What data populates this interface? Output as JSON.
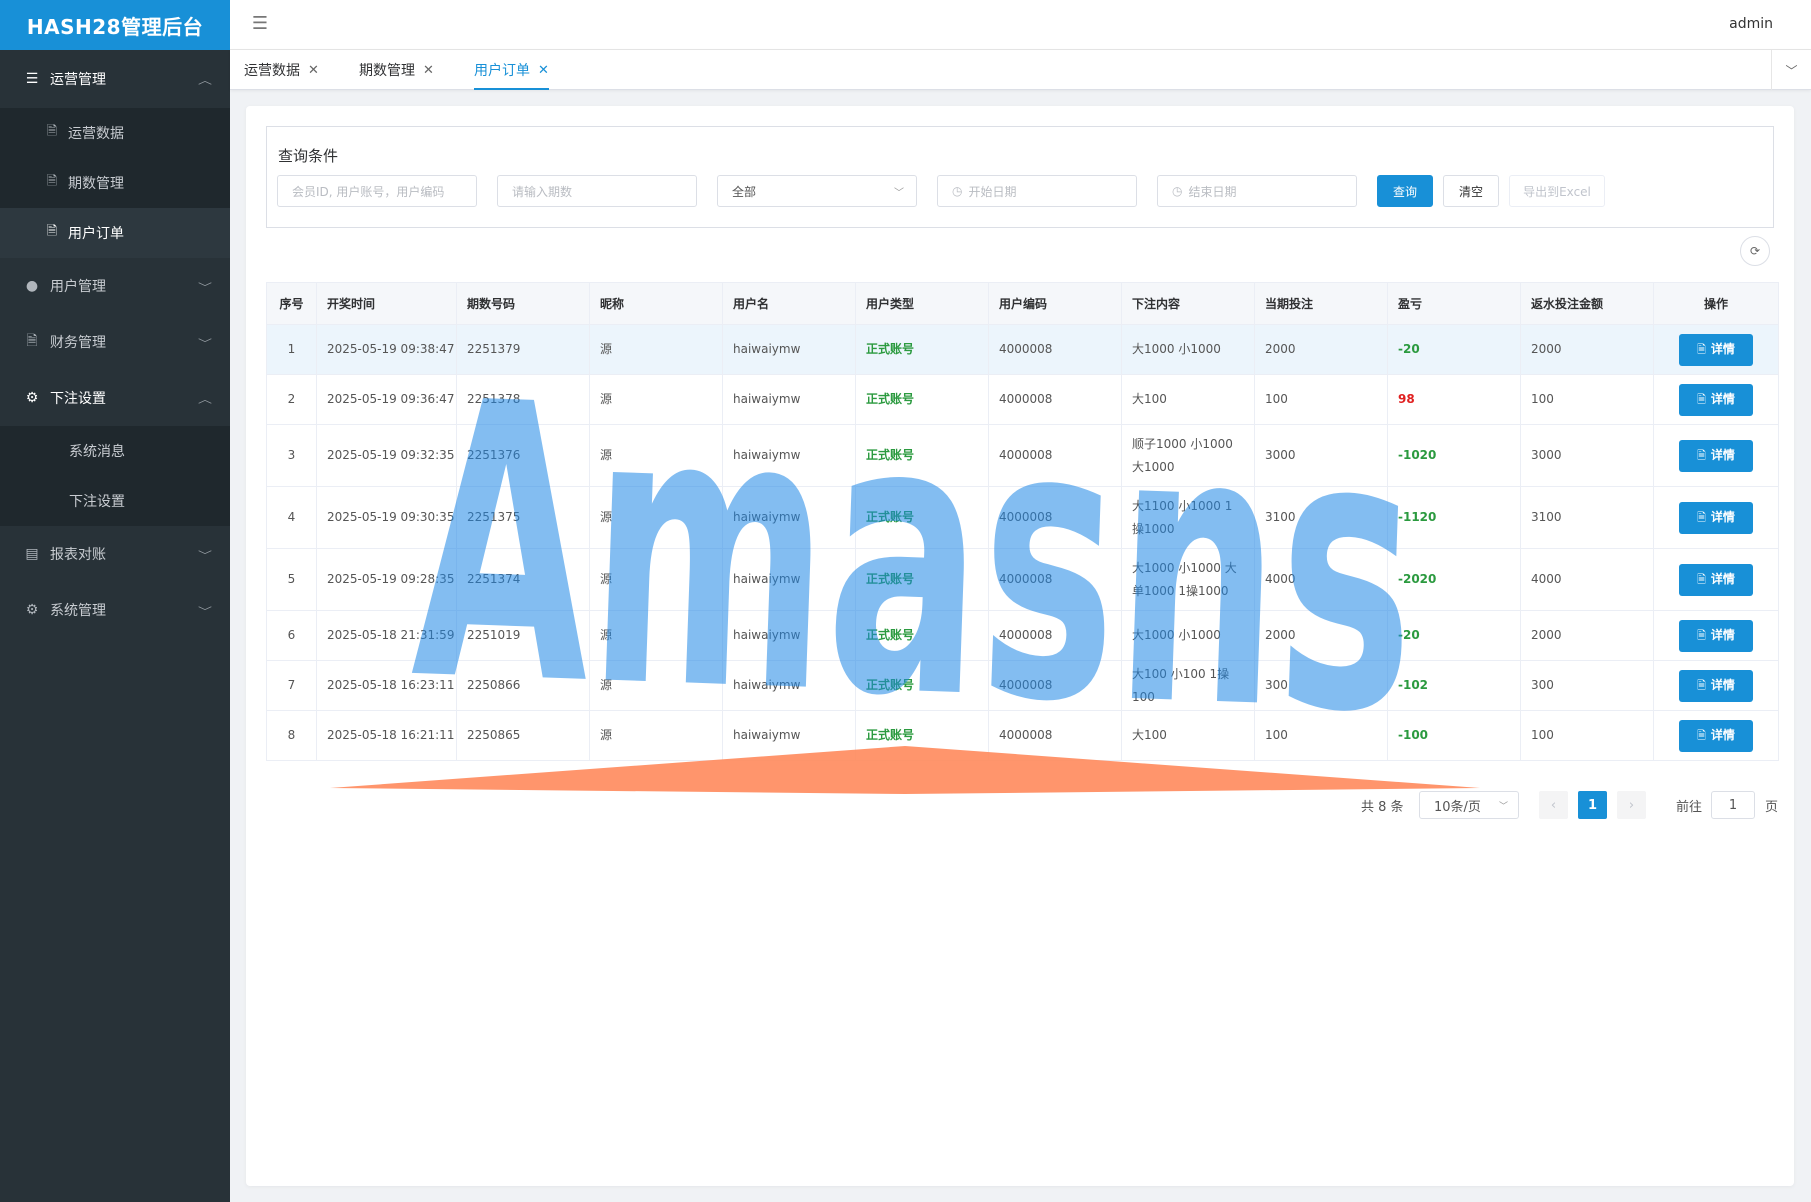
{
  "app": {
    "logo_text": "HASH28管理后台",
    "user": "admin"
  },
  "sidebar": {
    "groups": [
      {
        "label": "运营管理",
        "icon": "list-icon",
        "open": true,
        "items": [
          {
            "label": "运营数据",
            "icon": "doc-icon"
          },
          {
            "label": "期数管理",
            "icon": "doc-icon"
          },
          {
            "label": "用户订单",
            "icon": "doc-icon",
            "active": true
          }
        ]
      },
      {
        "label": "用户管理",
        "icon": "user-icon"
      },
      {
        "label": "财务管理",
        "icon": "doc-icon"
      },
      {
        "label": "下注设置",
        "icon": "gear-icon",
        "open": true,
        "items": [
          {
            "label": "系统消息"
          },
          {
            "label": "下注设置"
          }
        ]
      },
      {
        "label": "报表对账",
        "icon": "report-icon"
      },
      {
        "label": "系统管理",
        "icon": "gear-icon"
      }
    ]
  },
  "tabs": [
    {
      "label": "运营数据"
    },
    {
      "label": "期数管理"
    },
    {
      "label": "用户订单",
      "active": true
    }
  ],
  "query": {
    "title": "查询条件",
    "member_placeholder": "会员ID, 用户账号，用户编码",
    "period_placeholder": "请输入期数",
    "select_value": "全部",
    "start_placeholder": "开始日期",
    "end_placeholder": "结束日期",
    "search_label": "查询",
    "clear_label": "清空",
    "export_label": "导出到Excel"
  },
  "table": {
    "headers": [
      "序号",
      "开奖时间",
      "期数号码",
      "昵称",
      "用户名",
      "用户类型",
      "用户编码",
      "下注内容",
      "当期投注",
      "盈亏",
      "返水投注金额",
      "操作"
    ],
    "detail_label": "详情",
    "rows": [
      {
        "no": "1",
        "time": "2025-05-19 09:38:47",
        "period": "2251379",
        "nick": "源",
        "user": "haiwaiymw",
        "type": "正式账号",
        "code": "4000008",
        "bet": "大1000 小1000",
        "amount": "2000",
        "pl": "-20",
        "rebate": "2000"
      },
      {
        "no": "2",
        "time": "2025-05-19 09:36:47",
        "period": "2251378",
        "nick": "源",
        "user": "haiwaiymw",
        "type": "正式账号",
        "code": "4000008",
        "bet": "大100",
        "amount": "100",
        "pl": "98",
        "rebate": "100"
      },
      {
        "no": "3",
        "time": "2025-05-19 09:32:35",
        "period": "2251376",
        "nick": "源",
        "user": "haiwaiymw",
        "type": "正式账号",
        "code": "4000008",
        "bet": "顺子1000 小1000 大1000",
        "amount": "3000",
        "pl": "-1020",
        "rebate": "3000"
      },
      {
        "no": "4",
        "time": "2025-05-19 09:30:35",
        "period": "2251375",
        "nick": "源",
        "user": "haiwaiymw",
        "type": "正式账号",
        "code": "4000008",
        "bet": "大1100 小1000 1操1000",
        "amount": "3100",
        "pl": "-1120",
        "rebate": "3100"
      },
      {
        "no": "5",
        "time": "2025-05-19 09:28:35",
        "period": "2251374",
        "nick": "源",
        "user": "haiwaiymw",
        "type": "正式账号",
        "code": "4000008",
        "bet": "大1000 小1000 大单1000 1操1000",
        "amount": "4000",
        "pl": "-2020",
        "rebate": "4000"
      },
      {
        "no": "6",
        "time": "2025-05-18 21:31:59",
        "period": "2251019",
        "nick": "源",
        "user": "haiwaiymw",
        "type": "正式账号",
        "code": "4000008",
        "bet": "大1000 小1000",
        "amount": "2000",
        "pl": "-20",
        "rebate": "2000"
      },
      {
        "no": "7",
        "time": "2025-05-18 16:23:11",
        "period": "2250866",
        "nick": "源",
        "user": "haiwaiymw",
        "type": "正式账号",
        "code": "4000008",
        "bet": "大100 小100 1操100",
        "amount": "300",
        "pl": "-102",
        "rebate": "300"
      },
      {
        "no": "8",
        "time": "2025-05-18 16:21:11",
        "period": "2250865",
        "nick": "源",
        "user": "haiwaiymw",
        "type": "正式账号",
        "code": "4000008",
        "bet": "大100",
        "amount": "100",
        "pl": "-100",
        "rebate": "100"
      }
    ]
  },
  "pagination": {
    "total_text": "共 8 条",
    "page_size": "10条/页",
    "current_page": "1",
    "goto_label": "前往",
    "goto_value": "1",
    "page_suffix": "页"
  },
  "watermark": {
    "text": "Amasns",
    "color": "#1e87e5",
    "accent_color": "#ff8a5c"
  },
  "colors": {
    "primary": "#1890d7",
    "sidebar_bg": "#283238",
    "loss": "#2b9a3f",
    "profit": "#e02020"
  }
}
